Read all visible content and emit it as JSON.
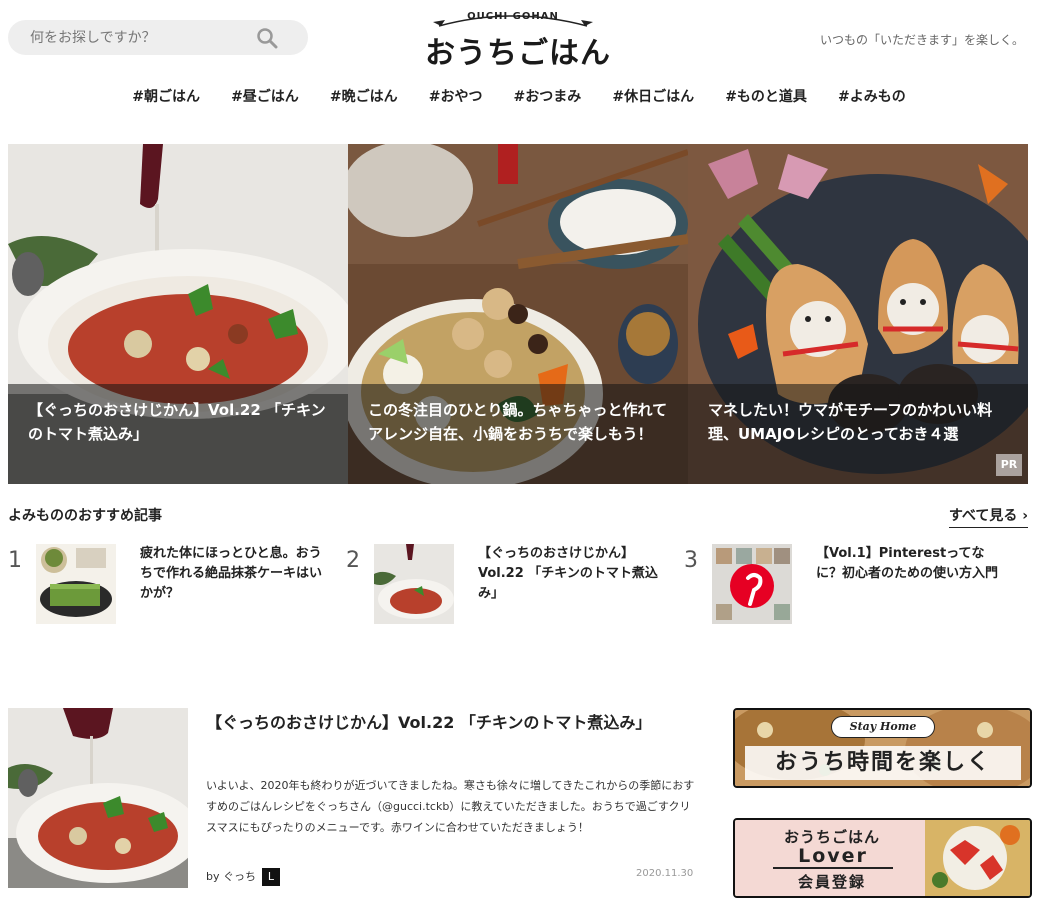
{
  "search": {
    "placeholder": "何をお探しですか？"
  },
  "logo": {
    "ribbon": "OUCHI GOHAN",
    "main": "おうちごはん"
  },
  "tagline": "いつもの「いただきます」を楽しく。",
  "nav": [
    "#朝ごはん",
    "#昼ごはん",
    "#晩ごはん",
    "#おやつ",
    "#おつまみ",
    "#休日ごはん",
    "#ものと道具",
    "#よみもの"
  ],
  "hero": [
    {
      "title": "【ぐっちのおさけじかん】Vol.22 「チキンのトマト煮込み」"
    },
    {
      "title": "この冬注目のひとり鍋。ちゃちゃっと作れてアレンジ自在、小鍋をおうちで楽しもう！"
    },
    {
      "title": "マネしたい！ウマがモチーフのかわいい料理、UMAJOレシピのとっておき４選",
      "badge": "PR"
    }
  ],
  "recommend": {
    "heading": "よみもののおすすめ記事",
    "see_all": "すべて見る",
    "items": [
      {
        "num": "1",
        "title": "疲れた体にほっとひと息。おうちで作れる絶品抹茶ケーキはいかが？"
      },
      {
        "num": "2",
        "title": "【ぐっちのおさけじかん】Vol.22 「チキンのトマト煮込み」"
      },
      {
        "num": "3",
        "title": "【Vol.1】Pinterestってなに？初心者のための使い方入門"
      }
    ]
  },
  "feature": {
    "title": "【ぐっちのおさけじかん】Vol.22 「チキンのトマト煮込み」",
    "body": "いよいよ、2020年も終わりが近づいてきましたね。寒さも徐々に増してきたこれからの季節におすすめのごはんレシピをぐっちさん（@gucci.tckb）に教えていただきました。おうちで過ごすクリスマスにもぴったりのメニューです。赤ワインに合わせていただきましょう！",
    "by": "by ぐっち",
    "author_logo": "L",
    "date": "2020.11.30"
  },
  "banners": {
    "stay_home": {
      "badge": "Stay Home",
      "text": "おうち時間を楽しく"
    },
    "lover": {
      "line1": "おうちごはん",
      "line2": "Lover",
      "line3": "会員登録"
    }
  }
}
